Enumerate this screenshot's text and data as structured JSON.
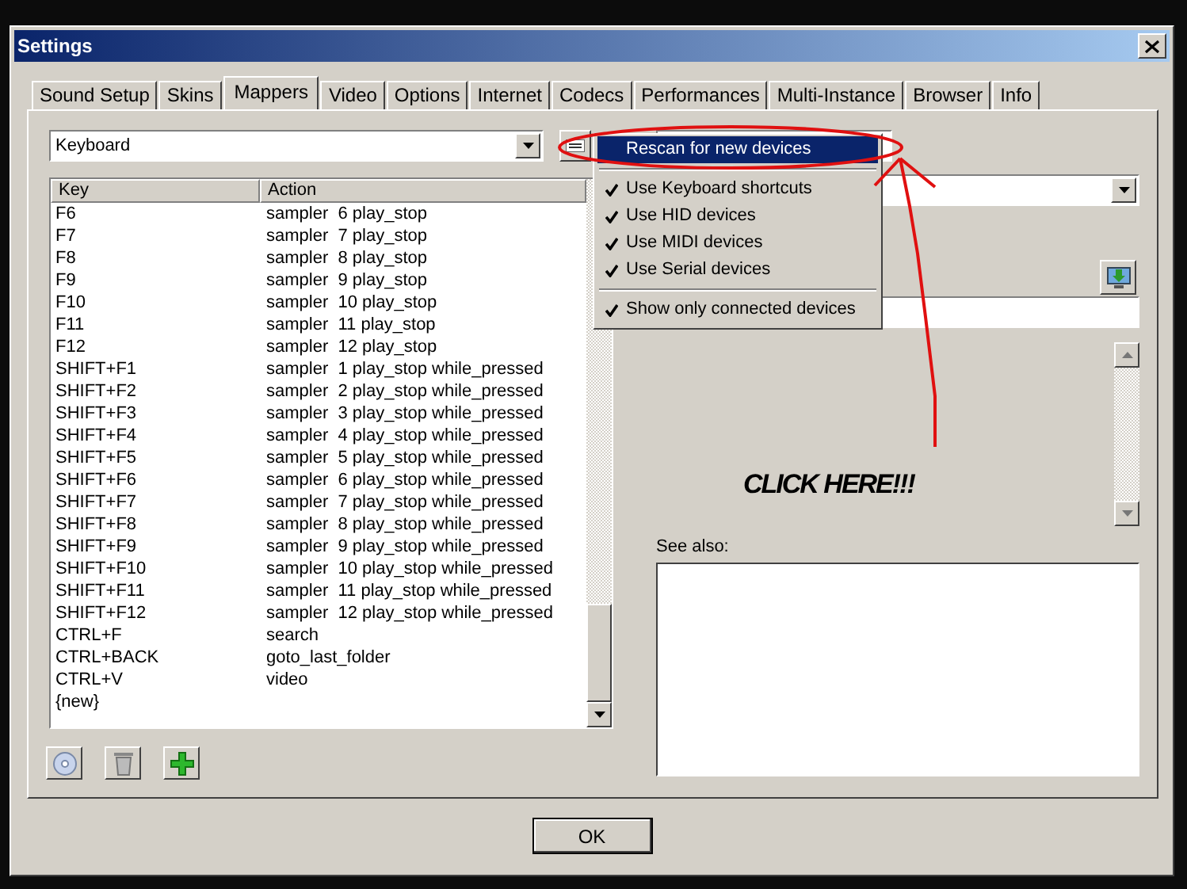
{
  "window": {
    "title": "Settings"
  },
  "tabs": [
    {
      "label": "Sound Setup",
      "selected": false
    },
    {
      "label": "Skins",
      "selected": false
    },
    {
      "label": "Mappers",
      "selected": true
    },
    {
      "label": "Video",
      "selected": false
    },
    {
      "label": "Options",
      "selected": false
    },
    {
      "label": "Internet",
      "selected": false
    },
    {
      "label": "Codecs",
      "selected": false
    },
    {
      "label": "Performances",
      "selected": false
    },
    {
      "label": "Multi-Instance",
      "selected": false
    },
    {
      "label": "Browser",
      "selected": false
    },
    {
      "label": "Info",
      "selected": false
    }
  ],
  "mapper_dropdown": {
    "value": "Keyboard"
  },
  "table": {
    "columns": [
      "Key",
      "Action"
    ],
    "rows": [
      [
        "F6",
        "sampler  6 play_stop"
      ],
      [
        "F7",
        "sampler  7 play_stop"
      ],
      [
        "F8",
        "sampler  8 play_stop"
      ],
      [
        "F9",
        "sampler  9 play_stop"
      ],
      [
        "F10",
        "sampler  10 play_stop"
      ],
      [
        "F11",
        "sampler  11 play_stop"
      ],
      [
        "F12",
        "sampler  12 play_stop"
      ],
      [
        "SHIFT+F1",
        "sampler  1 play_stop while_pressed"
      ],
      [
        "SHIFT+F2",
        "sampler  2 play_stop while_pressed"
      ],
      [
        "SHIFT+F3",
        "sampler  3 play_stop while_pressed"
      ],
      [
        "SHIFT+F4",
        "sampler  4 play_stop while_pressed"
      ],
      [
        "SHIFT+F5",
        "sampler  5 play_stop while_pressed"
      ],
      [
        "SHIFT+F6",
        "sampler  6 play_stop while_pressed"
      ],
      [
        "SHIFT+F7",
        "sampler  7 play_stop while_pressed"
      ],
      [
        "SHIFT+F8",
        "sampler  8 play_stop while_pressed"
      ],
      [
        "SHIFT+F9",
        "sampler  9 play_stop while_pressed"
      ],
      [
        "SHIFT+F10",
        "sampler  10 play_stop while_pressed"
      ],
      [
        "SHIFT+F11",
        "sampler  11 play_stop while_pressed"
      ],
      [
        "SHIFT+F12",
        "sampler  12 play_stop while_pressed"
      ],
      [
        "CTRL+F",
        "search"
      ],
      [
        "CTRL+BACK",
        "goto_last_folder"
      ],
      [
        "CTRL+V",
        "video"
      ],
      [
        "{new}",
        ""
      ]
    ]
  },
  "context_menu": [
    {
      "kind": "action",
      "label": "Rescan for new devices",
      "selected": true
    },
    {
      "kind": "separator"
    },
    {
      "kind": "check",
      "label": "Use Keyboard shortcuts",
      "checked": true,
      "selected": false
    },
    {
      "kind": "check",
      "label": "Use HID devices",
      "checked": true,
      "selected": false
    },
    {
      "kind": "check",
      "label": "Use MIDI devices",
      "checked": true,
      "selected": false
    },
    {
      "kind": "check",
      "label": "Use Serial devices",
      "checked": true,
      "selected": false
    },
    {
      "kind": "separator"
    },
    {
      "kind": "check",
      "label": "Show only connected devices",
      "checked": true,
      "selected": false
    }
  ],
  "annotation": {
    "text": "CLICK HERE!!!"
  },
  "see_also": {
    "label": "See also:"
  },
  "ok_button": {
    "label": "OK"
  }
}
